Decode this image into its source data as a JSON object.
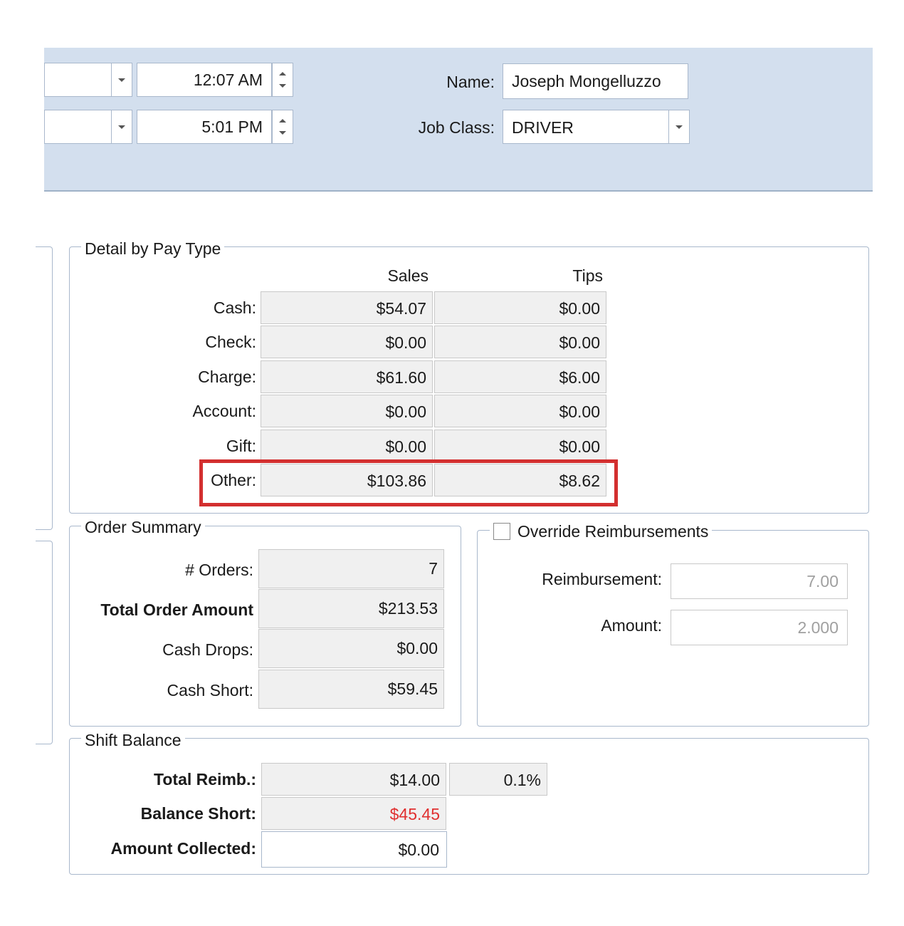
{
  "header": {
    "start_time": "12:07 AM",
    "end_time": "5:01 PM",
    "name_label": "Name:",
    "name_value": "Joseph Mongelluzzo",
    "jobclass_label": "Job Class:",
    "jobclass_value": "DRIVER"
  },
  "pay_type": {
    "legend": "Detail by Pay Type",
    "col_sales": "Sales",
    "col_tips": "Tips",
    "rows": [
      {
        "label": "Cash:",
        "sales": "$54.07",
        "tips": "$0.00"
      },
      {
        "label": "Check:",
        "sales": "$0.00",
        "tips": "$0.00"
      },
      {
        "label": "Charge:",
        "sales": "$61.60",
        "tips": "$6.00"
      },
      {
        "label": "Account:",
        "sales": "$0.00",
        "tips": "$0.00"
      },
      {
        "label": "Gift:",
        "sales": "$0.00",
        "tips": "$0.00"
      },
      {
        "label": "Other:",
        "sales": "$103.86",
        "tips": "$8.62"
      }
    ]
  },
  "order_summary": {
    "legend": "Order Summary",
    "rows": [
      {
        "label": "# Orders:",
        "value": "7"
      },
      {
        "label": "Total Order Amount",
        "value": "$213.53"
      },
      {
        "label": "Cash Drops:",
        "value": "$0.00"
      },
      {
        "label": "Cash Short:",
        "value": "$59.45"
      }
    ]
  },
  "override": {
    "legend": "Override Reimbursements",
    "checked": false,
    "reimbursement_label": "Reimbursement:",
    "reimbursement_value": "7.00",
    "amount_label": "Amount:",
    "amount_value": "2.000"
  },
  "shift_balance": {
    "legend": "Shift Balance",
    "total_reimb_label": "Total Reimb.:",
    "total_reimb_value": "$14.00",
    "total_reimb_pct": "0.1%",
    "balance_short_label": "Balance Short:",
    "balance_short_value": "$45.45",
    "amount_collected_label": "Amount Collected:",
    "amount_collected_value": "$0.00"
  },
  "colors": {
    "header_bg": "#d3dfee",
    "highlight": "#d32f2f",
    "negative_text": "#e03030"
  }
}
